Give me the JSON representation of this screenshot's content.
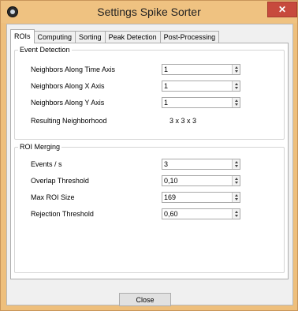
{
  "window": {
    "title": "Settings Spike Sorter",
    "close_glyph": "✕",
    "icon": "app-icon"
  },
  "tabs": [
    {
      "label": "ROIs",
      "active": true
    },
    {
      "label": "Computing",
      "active": false
    },
    {
      "label": "Sorting",
      "active": false
    },
    {
      "label": "Peak Detection",
      "active": false
    },
    {
      "label": "Post-Processing",
      "active": false
    }
  ],
  "event_detection": {
    "title": "Event Detection",
    "rows": [
      {
        "label": "Neighbors Along Time Axis",
        "value": "1"
      },
      {
        "label": "Neighbors Along X Axis",
        "value": "1"
      },
      {
        "label": "Neighbors Along Y Axis",
        "value": "1"
      }
    ],
    "resulting_label": "Resulting Neighborhood",
    "resulting_value": "3 x 3 x 3"
  },
  "roi_merging": {
    "title": "ROI Merging",
    "rows": [
      {
        "label": "Events / s",
        "value": "3"
      },
      {
        "label": "Overlap Threshold",
        "value": "0,10"
      },
      {
        "label": "Max ROI Size",
        "value": "169"
      },
      {
        "label": "Rejection Threshold",
        "value": "0,60"
      }
    ]
  },
  "footer": {
    "close_label": "Close"
  },
  "colors": {
    "frame": "#eebf7c",
    "close_button": "#c74a3d"
  }
}
